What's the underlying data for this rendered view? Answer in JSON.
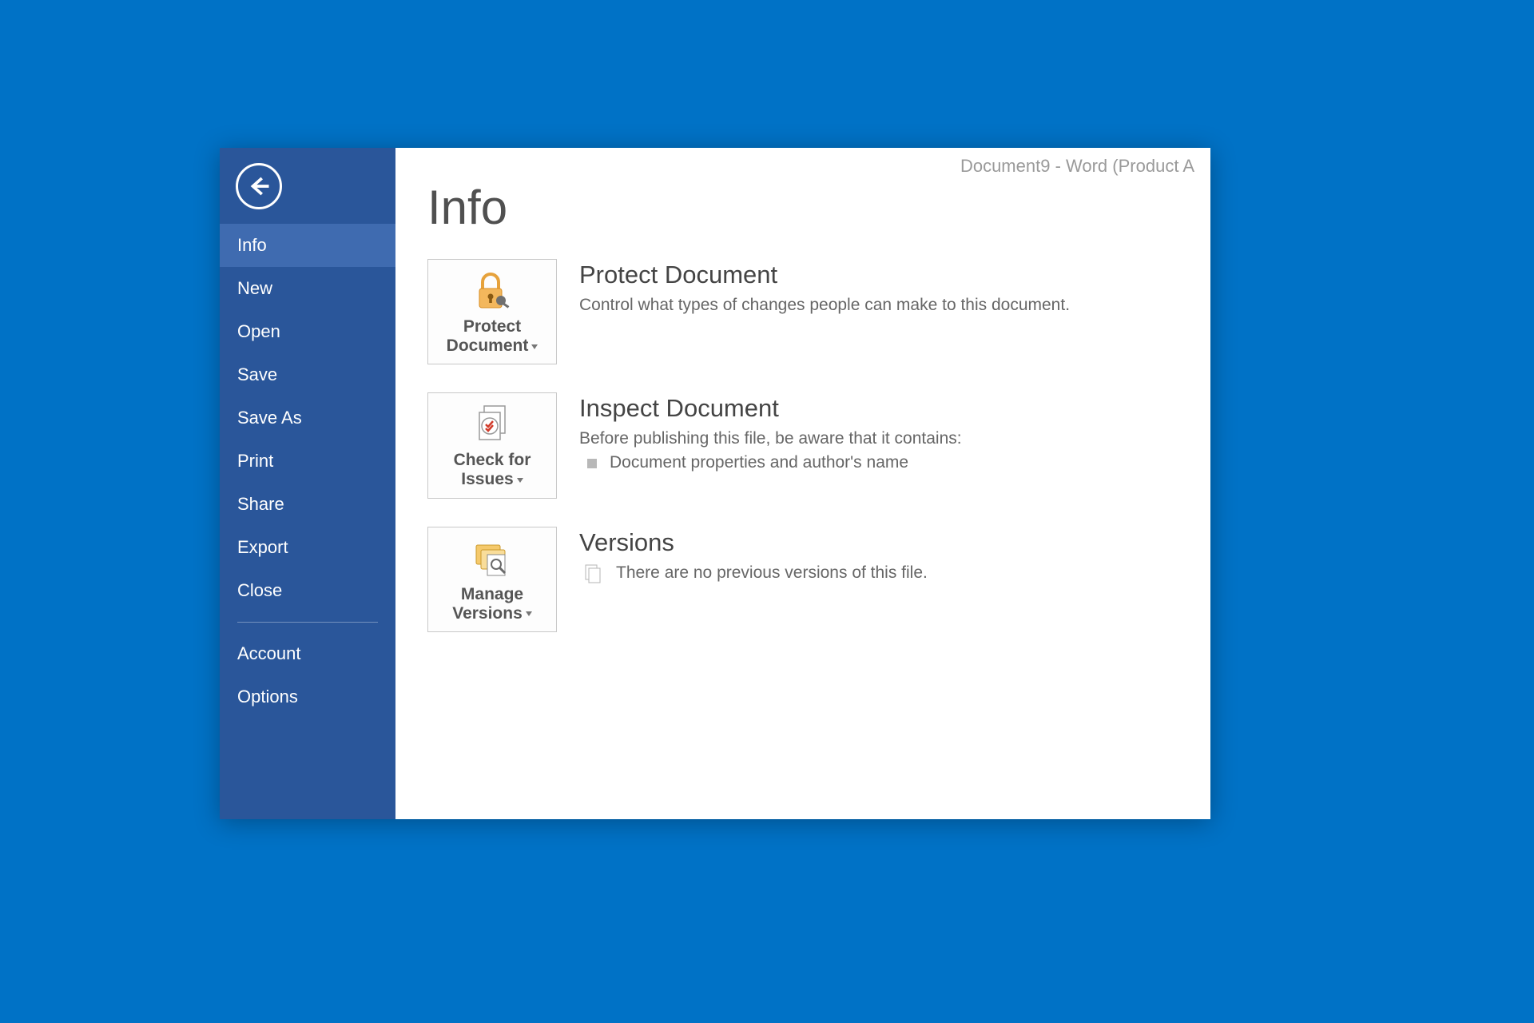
{
  "window_title": "Document9 - Word (Product A",
  "page_heading": "Info",
  "sidebar": {
    "items": [
      {
        "label": "Info",
        "active": true
      },
      {
        "label": "New"
      },
      {
        "label": "Open"
      },
      {
        "label": "Save"
      },
      {
        "label": "Save As"
      },
      {
        "label": "Print"
      },
      {
        "label": "Share"
      },
      {
        "label": "Export"
      },
      {
        "label": "Close"
      }
    ],
    "bottom_items": [
      {
        "label": "Account"
      },
      {
        "label": "Options"
      }
    ]
  },
  "sections": {
    "protect": {
      "button_line1": "Protect",
      "button_line2": "Document",
      "heading": "Protect Document",
      "desc": "Control what types of changes people can make to this document."
    },
    "inspect": {
      "button_line1": "Check for",
      "button_line2": "Issues",
      "heading": "Inspect Document",
      "desc": "Before publishing this file, be aware that it contains:",
      "item1": "Document properties and author's name"
    },
    "versions": {
      "button_line1": "Manage",
      "button_line2": "Versions",
      "heading": "Versions",
      "desc": "There are no previous versions of this file."
    }
  }
}
